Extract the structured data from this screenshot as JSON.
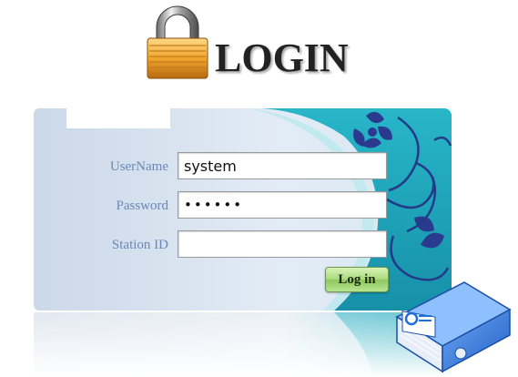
{
  "header": {
    "title": "LOGIN",
    "icon": "padlock-icon"
  },
  "form": {
    "username_label": "UserName",
    "username_value": "system",
    "password_label": "Password",
    "password_value": "••••••",
    "station_label": "Station ID",
    "station_value": "",
    "login_button": "Log in"
  },
  "colors": {
    "label": "#6a87b8",
    "panel_light": "#d9e3ef",
    "panel_teal": "#1fa3b8",
    "button_green": "#a8d97a"
  }
}
